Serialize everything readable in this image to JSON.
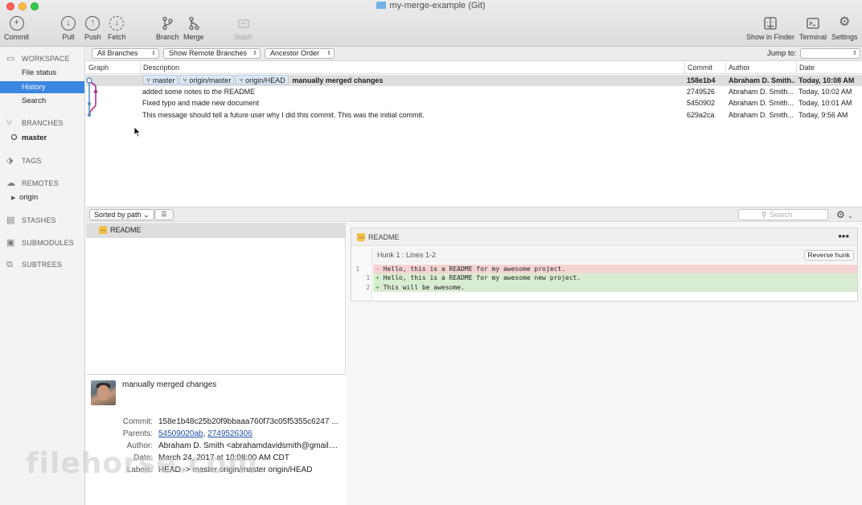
{
  "window": {
    "title": "my-merge-example (Git)"
  },
  "toolbar": {
    "commit": "Commit",
    "pull": "Pull",
    "push": "Push",
    "fetch": "Fetch",
    "branch": "Branch",
    "merge": "Merge",
    "stash": "Stash",
    "show_in_finder": "Show in Finder",
    "terminal": "Terminal",
    "settings": "Settings"
  },
  "sidebar": {
    "workspace": "WORKSPACE",
    "workspace_items": [
      "File status",
      "History",
      "Search"
    ],
    "selected": "History",
    "branches": "BRANCHES",
    "branch_items": [
      "master"
    ],
    "tags": "TAGS",
    "remotes": "REMOTES",
    "remote_items": [
      "origin"
    ],
    "stashes": "STASHES",
    "submodules": "SUBMODULES",
    "subtrees": "SUBTREES"
  },
  "filters": {
    "branches": "All Branches",
    "remote": "Show Remote Branches",
    "order": "Ancestor Order",
    "jump_to": "Jump to:"
  },
  "table": {
    "columns": {
      "graph": "Graph",
      "description": "Description",
      "commit": "Commit",
      "author": "Author",
      "date": "Date"
    },
    "refs": [
      "master",
      "origin/master",
      "origin/HEAD"
    ],
    "rows": [
      {
        "description": "manually merged changes",
        "commit": "158e1b4",
        "author": "Abraham D. Smith...",
        "date": "Today, 10:08 AM"
      },
      {
        "description": "added some notes to the README",
        "commit": "2749526",
        "author": "Abraham D. Smith...",
        "date": "Today, 10:02 AM"
      },
      {
        "description": "Fixed typo and made new document",
        "commit": "5450902",
        "author": "Abraham D. Smith...",
        "date": "Today, 10:01 AM"
      },
      {
        "description": "This message should tell a future user why I did this commit. This was the initial commit.",
        "commit": "629a2ca",
        "author": "Abraham D. Smith...",
        "date": "Today, 9:56 AM"
      }
    ]
  },
  "files": {
    "sort": "Sorted by path",
    "search_placeholder": "Search",
    "items": [
      "README"
    ]
  },
  "details": {
    "message": "manually merged changes",
    "labels": {
      "commit": "Commit:",
      "parents": "Parents:",
      "author": "Author:",
      "date": "Date:",
      "labels": "Labels:"
    },
    "commit": "158e1b48c25b20f9bbaaa760f73c05f5355c6247 ...",
    "parent1": "54509020ab",
    "parent2": "2749526306",
    "author": "Abraham D. Smith <abrahamdavidsmith@gmail....",
    "date": "March 24, 2017 at 10:08:00 AM CDT",
    "labels_value": "HEAD -> master origin/master origin/HEAD"
  },
  "diff": {
    "file": "README",
    "hunk": "Hunk 1 : Lines 1-2",
    "reverse": "Reverse hunk",
    "lines": [
      {
        "old": "1",
        "new": "",
        "sign": "-",
        "text": "Hello, this is a README for my awesome project."
      },
      {
        "old": "",
        "new": "1",
        "sign": "+",
        "text": "Hello, this is a README for my awesome new project."
      },
      {
        "old": "",
        "new": "2",
        "sign": "+",
        "text": "This will be awesome."
      }
    ]
  },
  "watermark": "filehorse.com",
  "colors": {
    "accent": "#3b86e2",
    "selected_row": "#dedede",
    "deleted": "#f6d3d3",
    "added": "#d8ecd1",
    "graph_blue": "#5b8fc7",
    "graph_magenta": "#b0308e"
  }
}
